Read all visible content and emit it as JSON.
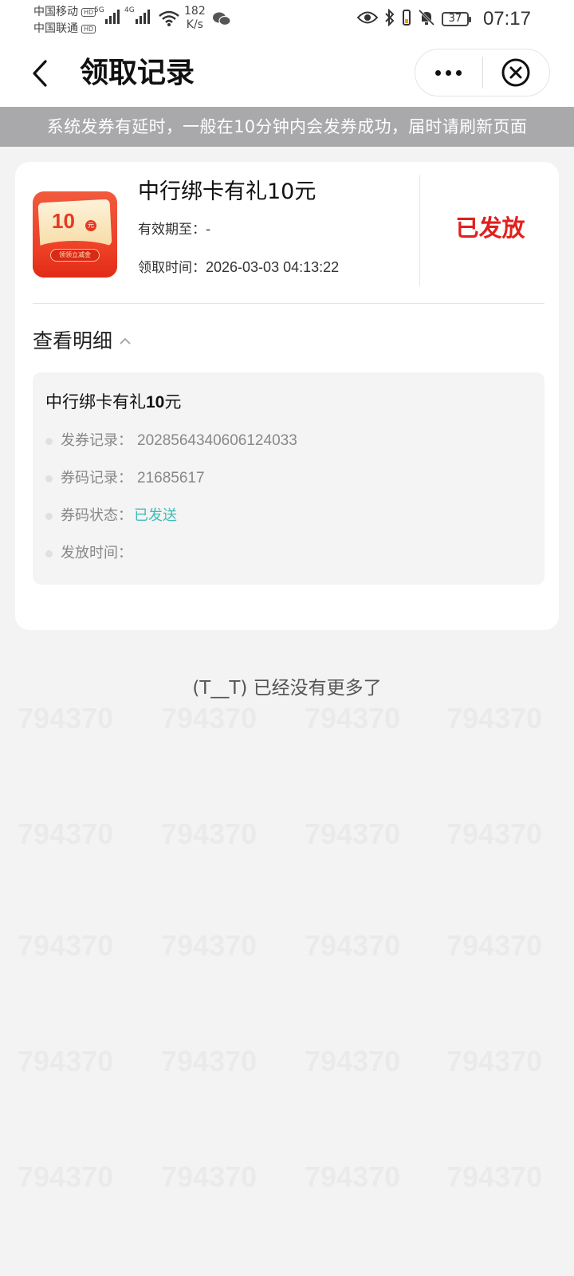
{
  "status_bar": {
    "carrier1": "中国移动",
    "carrier2": "中国联通",
    "hd_badge": "HD",
    "net1": "5G",
    "net2": "4G",
    "speed_value": "182",
    "speed_unit": "K/s",
    "battery": "37",
    "time": "07:17"
  },
  "nav": {
    "title": "领取记录"
  },
  "notice": "系统发券有延时，一般在10分钟内会发券成功，届时请刷新页面",
  "coupon": {
    "thumb_amount": "10",
    "thumb_unit": "元",
    "thumb_ribbon": "领领立减金",
    "title": "中行绑卡有礼10元",
    "valid_label": "有效期至：",
    "valid_value": "-",
    "claim_label": "领取时间：",
    "claim_value": "2026-03-03 04:13:22",
    "status": "已发放"
  },
  "detail": {
    "toggle_label": "查看明细",
    "title_prefix": "中行绑卡有礼",
    "title_amount": "10",
    "title_suffix": "元",
    "rows": [
      {
        "label": "发券记录：",
        "value": "2028564340606124033"
      },
      {
        "label": "券码记录：",
        "value": "21685617"
      },
      {
        "label": "券码状态：",
        "value": "已发送"
      },
      {
        "label": "发放时间：",
        "value": ""
      }
    ]
  },
  "footer": {
    "no_more": "(T__T) 已经没有更多了"
  },
  "watermark": "794370",
  "colors": {
    "status_red": "#e0211e",
    "status_green": "#3fbcb8",
    "notice_bg": "#a9a9ab"
  }
}
